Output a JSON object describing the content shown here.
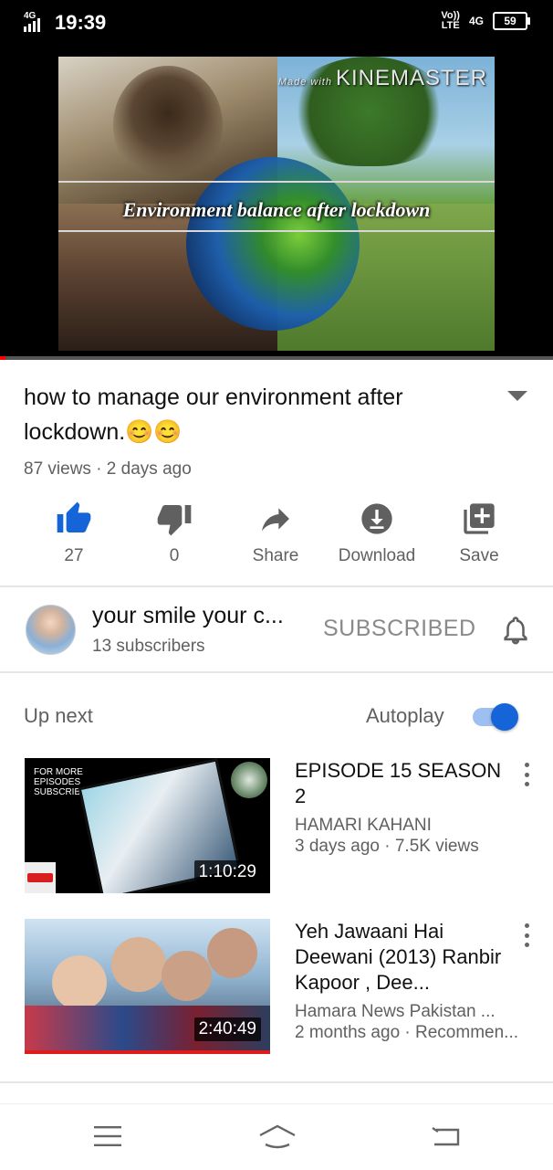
{
  "status_bar": {
    "network": "4G",
    "time": "19:39",
    "volte_top": "Vo))",
    "volte_bottom": "LTE",
    "network2": "4G",
    "battery": "59"
  },
  "player": {
    "overlay_title": "Environment balance after lockdown",
    "watermark_small": "Made with",
    "watermark_big": "KINEMASTER",
    "progress_fraction": 0.01
  },
  "video": {
    "title": "how to manage our environment after lockdown.😊😊",
    "meta": "87 views · 2 days ago"
  },
  "actions": [
    {
      "icon": "thumbs-up-icon",
      "label": "27",
      "active": true
    },
    {
      "icon": "thumbs-down-icon",
      "label": "0",
      "active": false
    },
    {
      "icon": "share-icon",
      "label": "Share",
      "active": false
    },
    {
      "icon": "download-icon",
      "label": "Download",
      "active": false
    },
    {
      "icon": "save-icon",
      "label": "Save",
      "active": false
    }
  ],
  "channel": {
    "name": "your smile your c...",
    "subscribers": "13 subscribers",
    "subscribe_label": "SUBSCRIBED"
  },
  "up_next": {
    "label": "Up next",
    "autoplay_label": "Autoplay",
    "autoplay_on": true
  },
  "items": [
    {
      "title": "EPISODE 15 SEASON 2",
      "channel": "HAMARI KAHANI",
      "meta": "3 days ago · 7.5K views",
      "duration": "1:10:29",
      "thumb_text": "FOR MORE\nEPISODES\nSUBSCRIBE"
    },
    {
      "title": "Yeh Jawaani Hai Deewani (2013) Ranbir Kapoor , Dee...",
      "channel": "Hamara News Pakistan ...",
      "meta": "2 months ago · Recommen...",
      "duration": "2:40:49"
    }
  ],
  "colors": {
    "accent": "#1565d8",
    "progress": "#ff0000",
    "muted": "#606060"
  }
}
